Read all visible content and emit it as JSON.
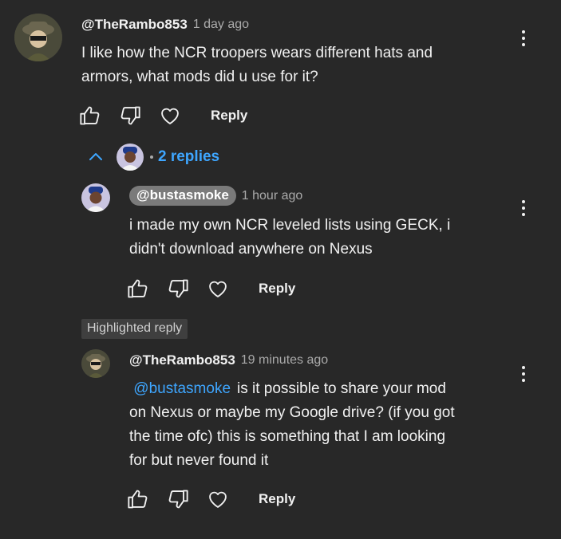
{
  "comment": {
    "author": "@TheRambo853",
    "time": "1 day ago",
    "lines": [
      "I like how the NCR troopers wears different hats and",
      "armors, what mods did u use for it?"
    ],
    "reply_label": "Reply"
  },
  "replies_toggle": {
    "count_label": "2 replies"
  },
  "reply1": {
    "author": "@bustasmoke",
    "time": "1 hour ago",
    "lines": [
      "i made my own NCR leveled lists using GECK, i",
      "didn't download anywhere on Nexus"
    ],
    "reply_label": "Reply"
  },
  "highlight": {
    "label": "Highlighted reply"
  },
  "reply2": {
    "author": "@TheRambo853",
    "time": "19 minutes ago",
    "mention": "@bustasmoke",
    "first_line_rest": "is it possible to share your mod",
    "lines": [
      "on Nexus or maybe my Google drive? (if you got",
      "the time ofc) this is something that I am looking",
      "for but never found it"
    ],
    "reply_label": "Reply"
  },
  "colors": {
    "background": "#282828",
    "link_blue": "#3ea6ff",
    "meta_gray": "#aaaaaa"
  },
  "icons": [
    "thumbs-up-icon",
    "thumbs-down-icon",
    "heart-icon",
    "more-vert-icon",
    "chevron-up-icon"
  ]
}
